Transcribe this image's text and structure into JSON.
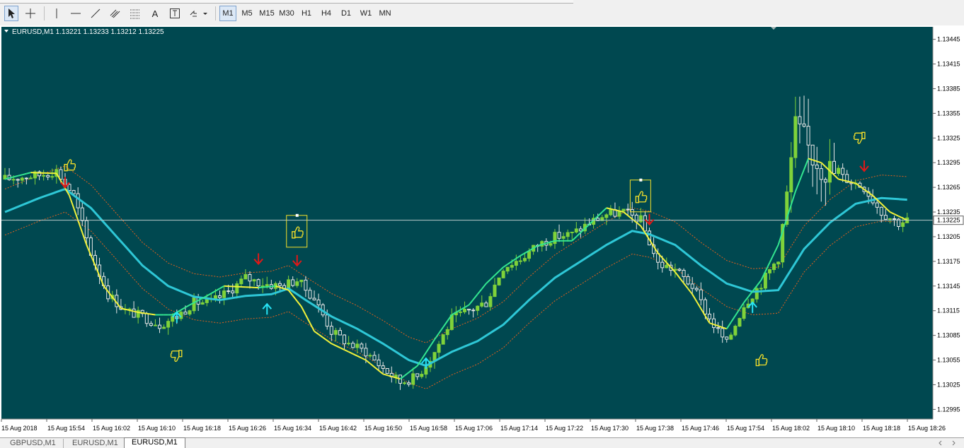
{
  "toolbar": {
    "draw_tools": [
      {
        "name": "cursor-tool",
        "icon": "cursor-arrow-icon"
      },
      {
        "name": "crosshair-tool",
        "icon": "crosshair-icon"
      },
      {
        "name": "vertical-line-tool",
        "icon": "vertical-line-icon"
      },
      {
        "name": "horizontal-line-tool",
        "icon": "horizontal-line-icon"
      },
      {
        "name": "trendline-tool",
        "icon": "trendline-icon"
      },
      {
        "name": "equidistant-channel-tool",
        "icon": "channel-icon"
      },
      {
        "name": "fibonacci-tool",
        "icon": "fibonacci-icon"
      },
      {
        "name": "text-tool",
        "label": "A",
        "icon": "text-icon"
      },
      {
        "name": "text-label-tool",
        "icon": "text-label-icon"
      },
      {
        "name": "arrows-tool",
        "icon": "arrows-dropdown-icon"
      }
    ],
    "timeframes": [
      "M1",
      "M5",
      "M15",
      "M30",
      "H1",
      "H4",
      "D1",
      "W1",
      "MN"
    ],
    "active_timeframe": "M1"
  },
  "chart": {
    "header": "EURUSD,M1  1.13221 1.13233 1.13212 1.13225",
    "current_price": "1.13225",
    "colors": {
      "background": "#004850",
      "bull_candle": "#7fd23a",
      "bear_candle": "#e8e8e8",
      "fast_line_up": "#33e690",
      "fast_line_down": "#f2f23a",
      "slow_line": "#2ec7d6",
      "band": "#e0601e",
      "arrow_up": "#27e3f5",
      "arrow_down": "#e01818",
      "thumb": "#f5e02a"
    }
  },
  "chart_data": {
    "type": "candlestick",
    "price_axis_ticks": [
      "1.13445",
      "1.13415",
      "1.13385",
      "1.13355",
      "1.13325",
      "1.13295",
      "1.13265",
      "1.13235",
      "1.13205",
      "1.13175",
      "1.13145",
      "1.13115",
      "1.13085",
      "1.13055",
      "1.13025",
      "1.12995"
    ],
    "time_axis_ticks": [
      "15 Aug 2018",
      "15 Aug 15:54",
      "15 Aug 16:02",
      "15 Aug 16:10",
      "15 Aug 16:18",
      "15 Aug 16:26",
      "15 Aug 16:34",
      "15 Aug 16:42",
      "15 Aug 16:50",
      "15 Aug 16:58",
      "15 Aug 17:06",
      "15 Aug 17:14",
      "15 Aug 17:22",
      "15 Aug 17:30",
      "15 Aug 17:38",
      "15 Aug 17:46",
      "15 Aug 17:54",
      "15 Aug 18:02",
      "15 Aug 18:10",
      "15 Aug 18:18",
      "15 Aug 18:26"
    ],
    "ylim": [
      1.12985,
      1.13455
    ],
    "close_anchors": [
      [
        0,
        1.13275
      ],
      [
        8,
        1.1328
      ],
      [
        12,
        1.13285
      ],
      [
        16,
        1.13255
      ],
      [
        20,
        1.13185
      ],
      [
        24,
        1.13135
      ],
      [
        28,
        1.13115
      ],
      [
        32,
        1.13108
      ],
      [
        36,
        1.13098
      ],
      [
        40,
        1.13108
      ],
      [
        44,
        1.13125
      ],
      [
        48,
        1.13125
      ],
      [
        52,
        1.13138
      ],
      [
        56,
        1.13155
      ],
      [
        60,
        1.13148
      ],
      [
        64,
        1.13145
      ],
      [
        68,
        1.13152
      ],
      [
        72,
        1.1313
      ],
      [
        76,
        1.1309
      ],
      [
        80,
        1.13075
      ],
      [
        84,
        1.13065
      ],
      [
        88,
        1.13045
      ],
      [
        92,
        1.13028
      ],
      [
        96,
        1.13035
      ],
      [
        100,
        1.13065
      ],
      [
        104,
        1.13105
      ],
      [
        108,
        1.13115
      ],
      [
        112,
        1.13125
      ],
      [
        116,
        1.13168
      ],
      [
        120,
        1.13178
      ],
      [
        124,
        1.13195
      ],
      [
        128,
        1.13205
      ],
      [
        132,
        1.13208
      ],
      [
        136,
        1.13222
      ],
      [
        140,
        1.13232
      ],
      [
        144,
        1.13235
      ],
      [
        148,
        1.13225
      ],
      [
        152,
        1.13172
      ],
      [
        156,
        1.13165
      ],
      [
        160,
        1.13145
      ],
      [
        164,
        1.13105
      ],
      [
        168,
        1.13075
      ],
      [
        172,
        1.13122
      ],
      [
        176,
        1.13148
      ],
      [
        180,
        1.1318
      ],
      [
        184,
        1.13335
      ],
      [
        188,
        1.13305
      ],
      [
        192,
        1.13285
      ],
      [
        196,
        1.13275
      ],
      [
        200,
        1.13265
      ],
      [
        204,
        1.13235
      ],
      [
        208,
        1.13222
      ],
      [
        210,
        1.13225
      ]
    ],
    "fast_line": [
      [
        0,
        1.13275
      ],
      [
        6,
        1.13283
      ],
      [
        12,
        1.13282
      ],
      [
        15,
        1.13255
      ],
      [
        19,
        1.13195
      ],
      [
        23,
        1.13145
      ],
      [
        27,
        1.13118
      ],
      [
        31,
        1.13113
      ],
      [
        35,
        1.1311
      ],
      [
        39,
        1.1311
      ],
      [
        43,
        1.13122
      ],
      [
        47,
        1.13133
      ],
      [
        51,
        1.13145
      ],
      [
        55,
        1.13144
      ],
      [
        59,
        1.13143
      ],
      [
        63,
        1.13145
      ],
      [
        66,
        1.1314
      ],
      [
        69,
        1.1312
      ],
      [
        72,
        1.1309
      ],
      [
        76,
        1.13075
      ],
      [
        80,
        1.13065
      ],
      [
        84,
        1.13055
      ],
      [
        88,
        1.13038
      ],
      [
        92,
        1.13032
      ],
      [
        96,
        1.13048
      ],
      [
        100,
        1.1308
      ],
      [
        104,
        1.1311
      ],
      [
        108,
        1.13122
      ],
      [
        112,
        1.13148
      ],
      [
        116,
        1.13168
      ],
      [
        120,
        1.13182
      ],
      [
        124,
        1.13194
      ],
      [
        128,
        1.132
      ],
      [
        132,
        1.132
      ],
      [
        136,
        1.1322
      ],
      [
        140,
        1.1324
      ],
      [
        144,
        1.13235
      ],
      [
        148,
        1.13218
      ],
      [
        152,
        1.13185
      ],
      [
        156,
        1.13162
      ],
      [
        160,
        1.13135
      ],
      [
        164,
        1.131
      ],
      [
        168,
        1.13093
      ],
      [
        172,
        1.13125
      ],
      [
        176,
        1.13152
      ],
      [
        180,
        1.13195
      ],
      [
        184,
        1.1326
      ],
      [
        187,
        1.133
      ],
      [
        190,
        1.13295
      ],
      [
        194,
        1.13275
      ],
      [
        198,
        1.1327
      ],
      [
        202,
        1.13255
      ],
      [
        206,
        1.13235
      ],
      [
        210,
        1.13225
      ]
    ],
    "slow_line": [
      [
        0,
        1.13235
      ],
      [
        8,
        1.13252
      ],
      [
        14,
        1.13263
      ],
      [
        20,
        1.1324
      ],
      [
        26,
        1.13205
      ],
      [
        32,
        1.1317
      ],
      [
        38,
        1.13145
      ],
      [
        44,
        1.13132
      ],
      [
        50,
        1.13128
      ],
      [
        56,
        1.13133
      ],
      [
        62,
        1.13135
      ],
      [
        66,
        1.13142
      ],
      [
        70,
        1.13128
      ],
      [
        76,
        1.13108
      ],
      [
        82,
        1.13093
      ],
      [
        88,
        1.13075
      ],
      [
        94,
        1.13055
      ],
      [
        98,
        1.13048
      ],
      [
        104,
        1.13065
      ],
      [
        110,
        1.13078
      ],
      [
        116,
        1.13098
      ],
      [
        122,
        1.13128
      ],
      [
        128,
        1.13155
      ],
      [
        134,
        1.13175
      ],
      [
        140,
        1.13195
      ],
      [
        146,
        1.13212
      ],
      [
        150,
        1.13208
      ],
      [
        156,
        1.13195
      ],
      [
        162,
        1.1317
      ],
      [
        168,
        1.13148
      ],
      [
        174,
        1.13138
      ],
      [
        180,
        1.1314
      ],
      [
        186,
        1.1319
      ],
      [
        192,
        1.13222
      ],
      [
        198,
        1.13245
      ],
      [
        204,
        1.13252
      ],
      [
        210,
        1.1325
      ]
    ],
    "band_offset": 0.00028,
    "signals": [
      {
        "type": "arrow-down",
        "index": 14,
        "price": 1.1327
      },
      {
        "type": "thumb-up",
        "index": 15,
        "price": 1.13292
      },
      {
        "type": "arrow-up",
        "index": 40,
        "price": 1.13108
      },
      {
        "type": "thumb-down",
        "index": 40,
        "price": 1.1306
      },
      {
        "type": "arrow-down",
        "index": 59,
        "price": 1.13177
      },
      {
        "type": "arrow-up",
        "index": 61,
        "price": 1.13118
      },
      {
        "type": "thumb-up-boxed",
        "index": 68,
        "price": 1.13212
      },
      {
        "type": "arrow-down",
        "index": 68,
        "price": 1.13175
      },
      {
        "type": "arrow-up",
        "index": 98,
        "price": 1.13052
      },
      {
        "type": "thumb-up-boxed",
        "index": 148,
        "price": 1.13255
      },
      {
        "type": "arrow-down",
        "index": 150,
        "price": 1.13225
      },
      {
        "type": "arrow-up",
        "index": 174,
        "price": 1.1312
      },
      {
        "type": "thumb-up",
        "index": 176,
        "price": 1.13055
      },
      {
        "type": "arrow-down",
        "index": 200,
        "price": 1.1329
      },
      {
        "type": "thumb-down",
        "index": 199,
        "price": 1.13325
      }
    ]
  },
  "status_tabs": [
    {
      "label": "GBPUSD,M1",
      "active": false
    },
    {
      "label": "EURUSD,M1",
      "active": false
    },
    {
      "label": "EURUSD,M1",
      "active": true
    }
  ]
}
